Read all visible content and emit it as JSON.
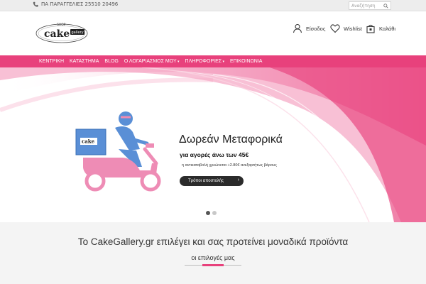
{
  "topbar": {
    "phone_text": "ΠΑ ΠΑΡΑΓΓΕΛΙΕΣ 25510 20496",
    "search_placeholder": "Αναζήτηση"
  },
  "header": {
    "logo_top": "SHOP",
    "logo_main": "cake",
    "logo_sub": "gallery",
    "login_label": "Είσοδος",
    "wishlist_label": "Wishlist",
    "cart_label": "Καλάθι"
  },
  "nav": {
    "items": [
      {
        "label": "ΚΕΝΤΡΙΚΗ"
      },
      {
        "label": "ΚΑΤΑΣΤΗΜΑ"
      },
      {
        "label": "BLOG"
      },
      {
        "label": "Ο ΛΟΓΑΡΙΑΣΜΟΣ ΜΟΥ"
      },
      {
        "label": "ΠΛΗΡΟΦΟΡΙΕΣ"
      },
      {
        "label": "ΕΠΙΚΟΙΝΩΝΙΑ"
      }
    ]
  },
  "hero": {
    "title": "Δωρεάν Μεταφορικά",
    "subtitle": "για αγορές άνω των 45€",
    "note": "η αντικαταβολή χρεώνεται +2.80€ ανεξαρτήτως βάρους",
    "button_label": "Τρόποι αποστολής",
    "box_label": "cake",
    "slide_count": 2,
    "active_slide": 1
  },
  "main": {
    "tagline": "Το CakeGallery.gr επιλέγει και σας προτείνει μοναδικά προϊόντα",
    "section_title": "οι επιλογές μας"
  },
  "colors": {
    "brand_pink": "#e8417c",
    "dark": "#2b2b2b",
    "delivery_blue": "#5a8fd6"
  }
}
